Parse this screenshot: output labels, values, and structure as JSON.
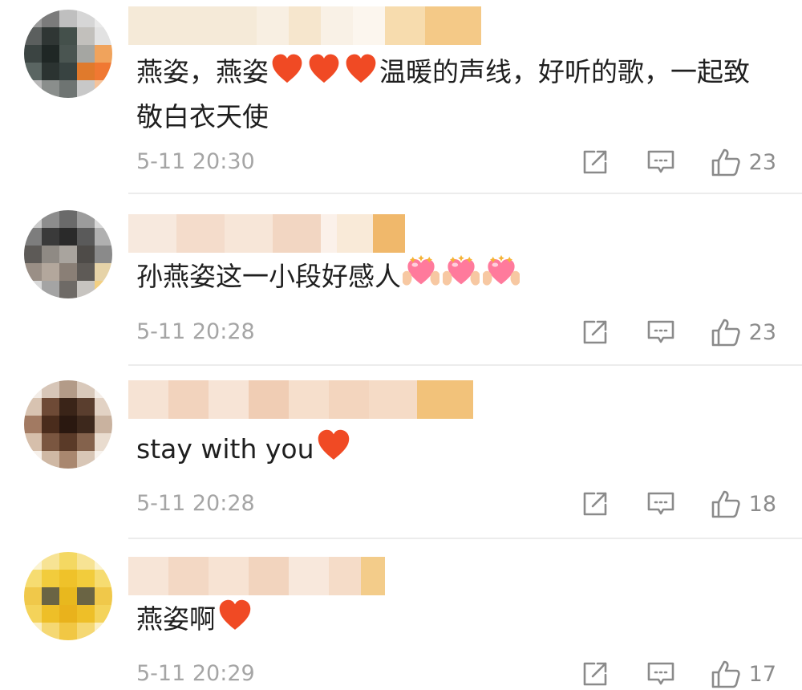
{
  "comments": [
    {
      "text": "燕姿，燕姿",
      "text_after": "温暖的声线，好听的歌，一起致敬白衣天使",
      "emoji_count": 3,
      "emoji_icon": "red-heart-icon",
      "timestamp": "5-11 20:30",
      "likes": "23"
    },
    {
      "text": "孙燕姿这一小段好感人",
      "text_after": "",
      "emoji_count": 3,
      "emoji_icon": "heart-hands-icon",
      "timestamp": "5-11 20:28",
      "likes": "23"
    },
    {
      "text": "stay with you",
      "text_after": "",
      "emoji_count": 1,
      "emoji_icon": "red-heart-icon",
      "timestamp": "5-11 20:28",
      "likes": "18"
    },
    {
      "text": "燕姿啊",
      "text_after": "",
      "emoji_count": 1,
      "emoji_icon": "red-heart-icon",
      "timestamp": "5-11 20:29",
      "likes": "17"
    }
  ],
  "icons": {
    "share": "share-icon",
    "reply": "reply-icon",
    "like": "thumbs-up-icon"
  },
  "colors": {
    "text": "#1f1f1f",
    "meta": "#a5a5a5",
    "heart": "#f04a24",
    "heart_hands": "#ff7a9c",
    "divider": "#ececec"
  }
}
